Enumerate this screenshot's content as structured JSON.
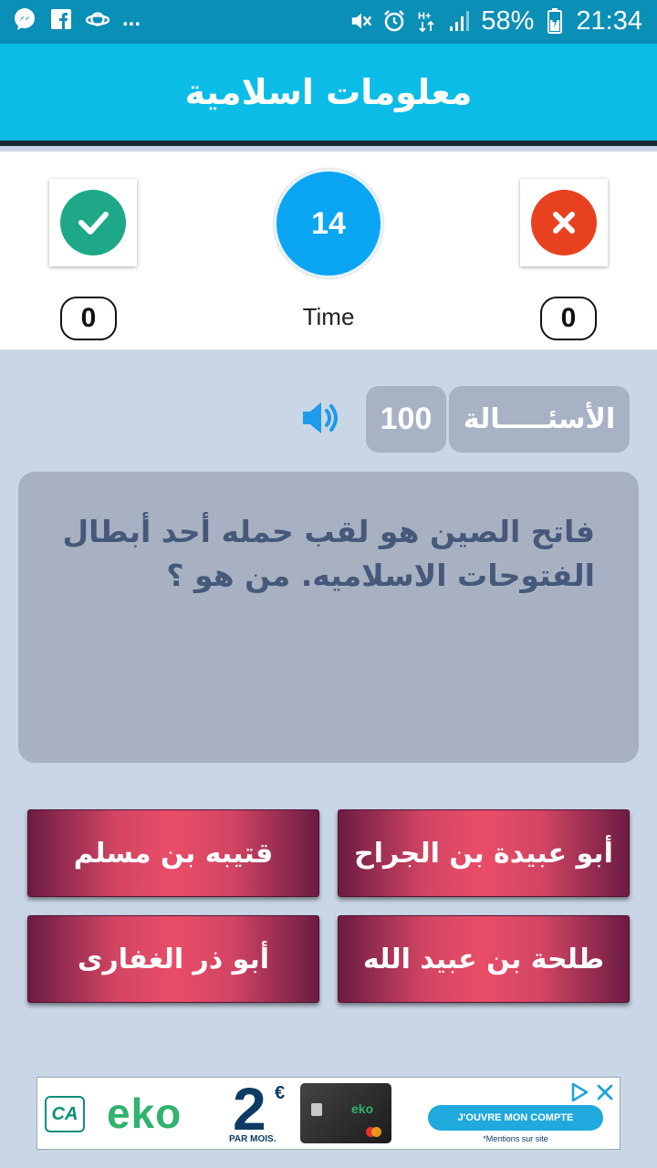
{
  "status_bar": {
    "left_icons": [
      "messenger-icon",
      "facebook-icon",
      "planet-icon"
    ],
    "more": "...",
    "right_icons": [
      "mute-icon",
      "alarm-icon",
      "hplus-signal-icon",
      "cell-signal-icon",
      "battery-icon"
    ],
    "battery": "58%",
    "time": "21:34"
  },
  "header": {
    "title": "معلومات اسلامية"
  },
  "score": {
    "correct_count": "0",
    "wrong_count": "0",
    "timer_value": "14",
    "timer_label": "Time"
  },
  "question": {
    "label": "الأسئـــــالة",
    "number": "100",
    "text": "فاتح الصين هو لقب حمله أحد أبطال الفتوحات الاسلاميه. من هو ؟"
  },
  "answers": [
    {
      "label": "أبو عبيدة بن الجراح"
    },
    {
      "label": "قتيبه بن مسلم"
    },
    {
      "label": "طلحة بن عبيد الله"
    },
    {
      "label": "أبو ذر الغفارى"
    }
  ],
  "ad": {
    "logo": "CA",
    "brand": "eko",
    "price": "2",
    "currency": "€",
    "price_sub": "PAR MOIS.",
    "card_brand": "eko",
    "cta": "J'OUVRE MON COMPTE",
    "note": "*Mentions sur site"
  },
  "colors": {
    "status_bar": "#0a8fb6",
    "title_bar": "#0bbde6",
    "correct": "#1fa888",
    "wrong": "#e8411f",
    "timer": "#0aa5f3",
    "answer_gradient_center": "#ea4d67",
    "answer_gradient_edge": "#6c1b43"
  }
}
